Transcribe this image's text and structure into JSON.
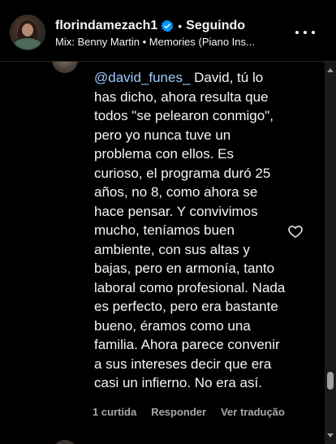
{
  "header": {
    "username": "florindamezach1",
    "separator": "•",
    "follow_status": "Seguindo",
    "music": "Mix: Benny Martin • Memories (Piano Ins..."
  },
  "comment": {
    "mention": "@david_funes_",
    "text": " David, tú lo has dicho, ahora resulta que todos \"se pelearon conmigo\", pero yo nunca tuve un problema con ellos. Es curioso, el programa duró 25 años, no 8, como ahora se hace pensar. Y convivimos mucho, teníamos buen ambiente, con sus altas y bajas, pero en armonía, tanto laboral como profesional. Nada es perfecto, pero era bastante bueno, éramos como una familia. Ahora parece convenir a sus intereses decir que era casi un infierno. No era así."
  },
  "actions": {
    "likes": "1 curtida",
    "reply": "Responder",
    "translate": "Ver tradução"
  },
  "colors": {
    "background": "#000000",
    "text": "#f5f5f5",
    "mention": "#9ccaff",
    "muted": "#a8a8a8",
    "verified": "#0095f6"
  },
  "icons": {
    "verified": "verified-badge-icon",
    "more": "more-options-icon",
    "like": "heart-icon"
  }
}
